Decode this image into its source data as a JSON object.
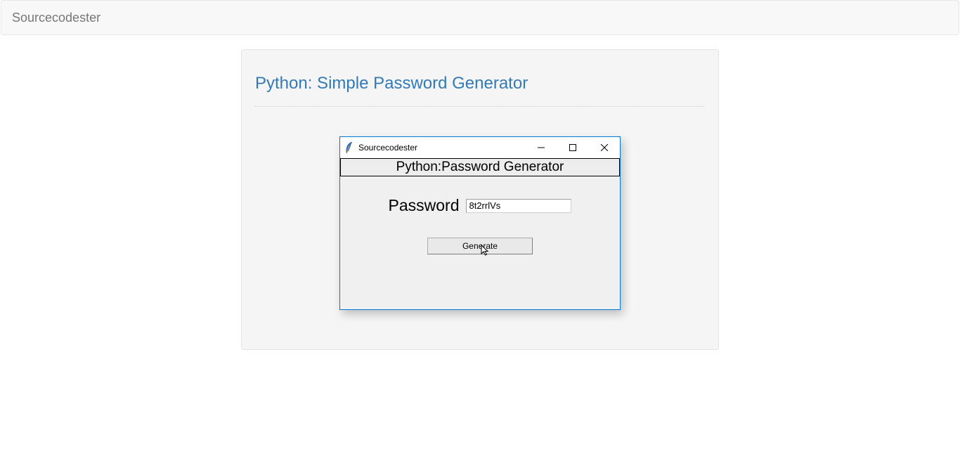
{
  "navbar": {
    "brand": "Sourcecodester"
  },
  "page": {
    "title": "Python: Simple Password Generator"
  },
  "window": {
    "title": "Sourcecodester",
    "header": "Python:Password Generator",
    "password_label": "Password",
    "password_value": "8t2rrlVs",
    "generate_label": "Generate"
  }
}
